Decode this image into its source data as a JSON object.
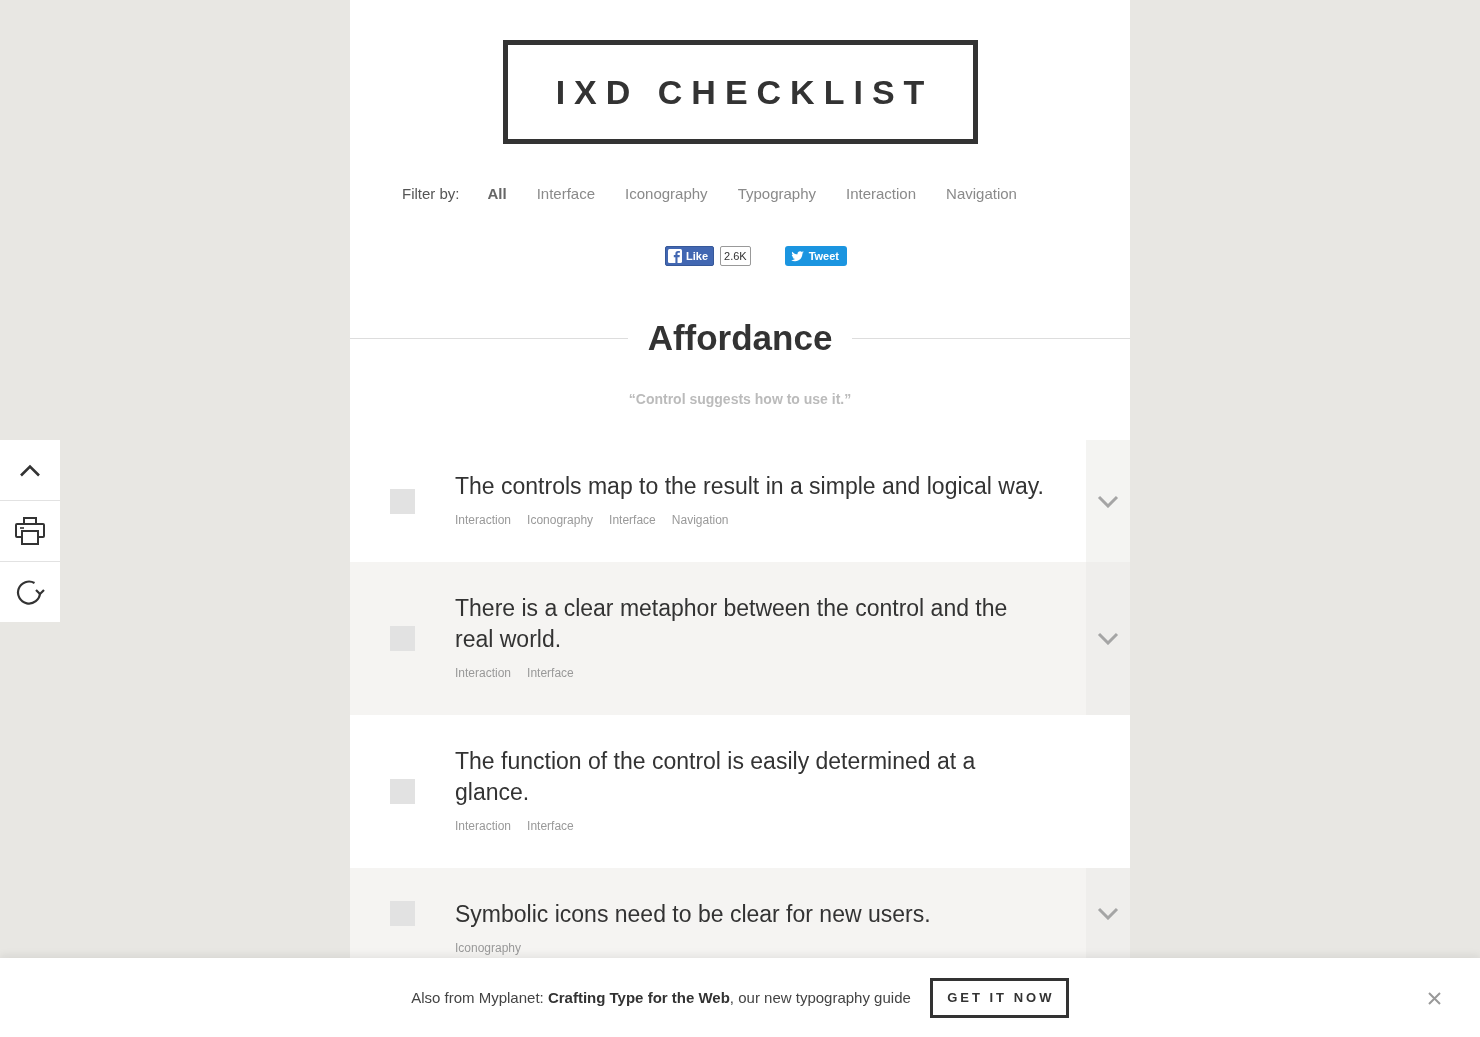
{
  "header": {
    "title": "IXD CHECKLIST"
  },
  "filter": {
    "label": "Filter by:",
    "options": [
      {
        "label": "All",
        "selected": true
      },
      {
        "label": "Interface",
        "selected": false
      },
      {
        "label": "Iconography",
        "selected": false
      },
      {
        "label": "Typography",
        "selected": false
      },
      {
        "label": "Interaction",
        "selected": false
      },
      {
        "label": "Navigation",
        "selected": false
      }
    ]
  },
  "social": {
    "like_label": "Like",
    "like_count": "2.6K",
    "tweet_label": "Tweet"
  },
  "section": {
    "title": "Affordance",
    "quote": "“Control suggests how to use it.”"
  },
  "items": [
    {
      "text": "The controls map to the result in a simple and logical way.",
      "checked": false,
      "expandable": true,
      "tags": [
        "Interaction",
        "Iconography",
        "Interface",
        "Navigation"
      ]
    },
    {
      "text": "There is a clear metaphor between the control and the real world.",
      "checked": false,
      "expandable": true,
      "tags": [
        "Interaction",
        "Interface"
      ]
    },
    {
      "text": "The function of the control is easily determined at a glance.",
      "checked": false,
      "expandable": false,
      "tags": [
        "Interaction",
        "Interface"
      ]
    },
    {
      "text": "Symbolic icons need to be clear for new users.",
      "checked": false,
      "expandable": true,
      "tags": [
        "Iconography"
      ]
    }
  ],
  "promo_bar": {
    "text": "Also from Myplanet: **Crafting Type for the Web**, our new typography guide",
    "button": "GET IT NOW"
  }
}
